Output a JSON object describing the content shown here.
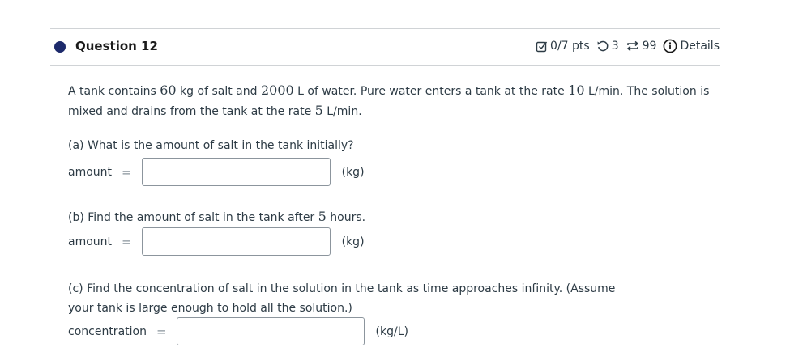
{
  "question": {
    "title": "Question 12",
    "points": "0/7 pts",
    "attempts": "3",
    "submissions": "99",
    "details_label": "Details"
  },
  "problem": {
    "t1": "A tank contains ",
    "n1": "60",
    "t2": " kg of salt and ",
    "n2": "2000",
    "t3": " L of water. Pure water enters a tank at the rate ",
    "n3": "10",
    "t4": " L/min. The solution is mixed and drains from the tank at the rate ",
    "n4": "5",
    "t5": " L/min."
  },
  "part_a": {
    "question": "(a) What is the amount of salt in the tank initially?",
    "label": "amount",
    "equals": "=",
    "value": "",
    "unit": "(kg)"
  },
  "part_b": {
    "q1": "(b) Find the amount of salt in the tank after ",
    "n": "5",
    "q2": " hours.",
    "label": "amount",
    "equals": "=",
    "value": "",
    "unit": "(kg)"
  },
  "part_c": {
    "line1": "(c) Find the concentration of salt in the solution in the tank as time approaches infinity. (Assume",
    "line2": "your tank is large enough to hold all the solution.)",
    "label": "concentration",
    "equals": "=",
    "value": "",
    "unit": "(kg/L)"
  },
  "icons": {
    "status": "status-dot",
    "points": "checkbox-pencil-icon",
    "attempts": "retry-icon",
    "submissions": "repeat-icon",
    "details": "info-icon"
  },
  "colors": {
    "dot": "#1d2a6b",
    "text": "#2d3b45",
    "rule": "#d0d3d6",
    "input_border": "#8c959d"
  }
}
